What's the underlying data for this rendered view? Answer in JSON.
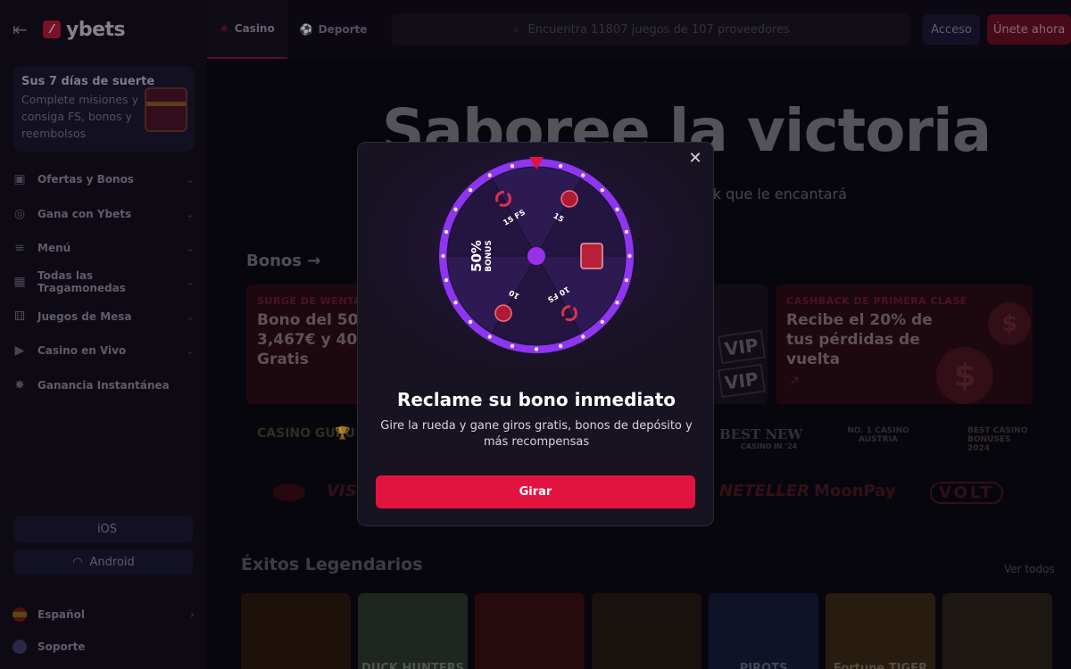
{
  "sidebar": {
    "logo": "ybets",
    "promo": {
      "title": "Sus 7 días de suerte",
      "desc": "Complete misiones y consiga FS, bonos y reembolsos"
    },
    "items": [
      {
        "label": "Ofertas y Bonos",
        "icon": "gift-icon"
      },
      {
        "label": "Gana con Ybets",
        "icon": "coins-icon"
      },
      {
        "label": "Menú",
        "icon": "menu-icon"
      },
      {
        "label": "Todas las Tragamonedas",
        "icon": "grid-icon"
      },
      {
        "label": "Juegos de Mesa",
        "icon": "dice-icon"
      },
      {
        "label": "Casino en Vivo",
        "icon": "play-icon"
      },
      {
        "label": "Ganancia Instantánea",
        "icon": "burst-icon"
      }
    ],
    "ios_label": "iOS",
    "android_label": "Android",
    "language": "Español",
    "support": "Soporte"
  },
  "header": {
    "tabs": [
      {
        "label": "Casino"
      },
      {
        "label": "Deporte"
      }
    ],
    "search_placeholder": "Encuentra 11807 juegos de 107 proveedores",
    "login": "Acceso",
    "join": "Únete ahora"
  },
  "hero": {
    "title": "Saboree la victoria",
    "subtitle": "ck que le encantará"
  },
  "bonuses": {
    "title": "Bonos →",
    "card1_tag": "SURGE DE WENTA",
    "card1_text": "Bono del 500 3,467€ y 400 Gratis",
    "card2_tag": "CASHBACK DE PRIMERA CLASE",
    "card2_text": "Recibe el 20% de tus pérdidas de vuelta",
    "vip": "VIP"
  },
  "awards": {
    "casino_guru": "CASINO GURU",
    "best_new": "BEST NEW",
    "best_new_sub": "CASINO IN '24",
    "austria": "NO. 1 CASINO AUSTRIA",
    "best_bonuses": "BEST CASINO BONUSES",
    "best_bonuses_year": "2024"
  },
  "payments": {
    "visa": "VIS",
    "neteller": "NETELLER",
    "moonpay": "MoonPay",
    "volt": "VOLT"
  },
  "legend": {
    "title": "Éxitos Legendarios",
    "see_all": "Ver todos",
    "games": [
      "",
      "DUCK HUNTERS",
      "",
      "",
      "PIROTS",
      "Fortune TIGER",
      ""
    ]
  },
  "modal": {
    "title": "Reclame su bono inmediato",
    "desc": "Gire la rueda y gane giros gratis, bonos de depósito y más recompensas",
    "button": "Girar",
    "wheel": {
      "segments": [
        "15 FS",
        "15",
        "gift",
        "10 FS",
        "10",
        "50% BONUS"
      ],
      "bonus_big": "50%",
      "bonus_small": "BONUS"
    }
  },
  "colors": {
    "accent": "#e2133e",
    "wheel_ring": "#8a2be2",
    "wheel_center": "#9b30e6"
  }
}
